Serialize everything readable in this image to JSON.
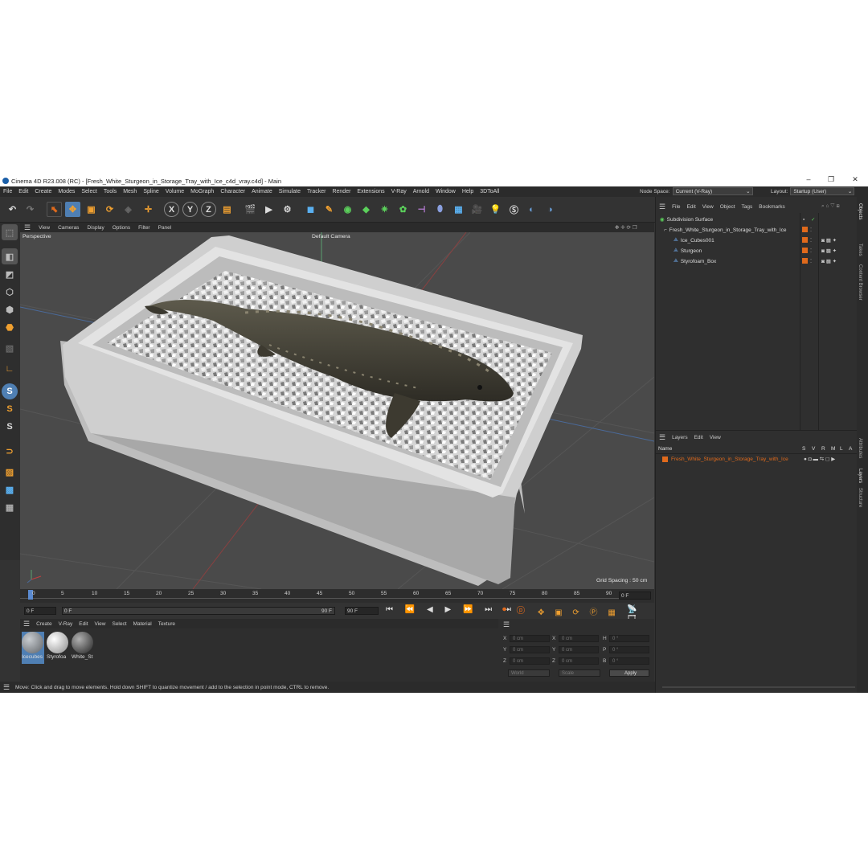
{
  "title": "Cinema 4D R23.008 (RC) - [Fresh_White_Sturgeon_in_Storage_Tray_with_Ice_c4d_vray.c4d] - Main",
  "menu": [
    "File",
    "Edit",
    "Create",
    "Modes",
    "Select",
    "Tools",
    "Mesh",
    "Spline",
    "Volume",
    "MoGraph",
    "Character",
    "Animate",
    "Simulate",
    "Tracker",
    "Render",
    "Extensions",
    "V-Ray",
    "Arnold",
    "Window",
    "Help",
    "3DToAll"
  ],
  "node_space_label": "Node Space:",
  "node_space_value": "Current (V-Ray)",
  "layout_label": "Layout:",
  "layout_value": "Startup (User)",
  "viewport": {
    "menu": [
      "View",
      "Cameras",
      "Display",
      "Options",
      "Filter",
      "Panel"
    ],
    "name": "Perspective",
    "camera": "Default Camera",
    "grid_spacing": "Grid Spacing : 50 cm"
  },
  "timeline": {
    "ticks": [
      "0",
      "5",
      "10",
      "15",
      "20",
      "25",
      "30",
      "35",
      "40",
      "45",
      "50",
      "55",
      "60",
      "65",
      "70",
      "75",
      "80",
      "85",
      "90"
    ],
    "current_frame": "0 F",
    "start": "0 F",
    "range_start": "0 F",
    "range_end": "90 F",
    "end": "90 F"
  },
  "material_menu": [
    "Create",
    "V-Ray",
    "Edit",
    "View",
    "Select",
    "Material",
    "Texture"
  ],
  "materials": [
    {
      "name": "Icecubes",
      "color": "#8c9096"
    },
    {
      "name": "Styrofoa",
      "color": "#d0d0d0"
    },
    {
      "name": "White_St",
      "color": "#5a5c60"
    }
  ],
  "coords": {
    "rows": [
      {
        "a": "X",
        "av": "0 cm",
        "b": "X",
        "bv": "0 cm",
        "c": "H",
        "cv": "0 °"
      },
      {
        "a": "Y",
        "av": "0 cm",
        "b": "Y",
        "bv": "0 cm",
        "c": "P",
        "cv": "0 °"
      },
      {
        "a": "Z",
        "av": "0 cm",
        "b": "Z",
        "bv": "0 cm",
        "c": "B",
        "cv": "0 °"
      }
    ],
    "world": "World",
    "scale": "Scale",
    "apply": "Apply"
  },
  "status": "Move: Click and drag to move elements. Hold down SHIFT to quantize movement / add to the selection in point mode, CTRL to remove.",
  "objects": {
    "menu": [
      "File",
      "Edit",
      "View",
      "Object",
      "Tags",
      "Bookmarks"
    ],
    "items": [
      "Subdivision Surface",
      "Fresh_White_Sturgeon_in_Storage_Tray_with_Ice",
      "Ice_Cubes001",
      "Sturgeon",
      "Styrofoam_Box"
    ]
  },
  "layers": {
    "menu": [
      "Layers",
      "Edit",
      "View"
    ],
    "header_name": "Name",
    "header_cols": [
      "S",
      "V",
      "R",
      "M",
      "L",
      "A"
    ],
    "item": "Fresh_White_Sturgeon_in_Storage_Tray_with_Ice"
  },
  "side_tabs": [
    "Objects",
    "Takes",
    "Content Browser",
    "Attributes",
    "Layers",
    "Structure"
  ],
  "colors": {
    "accent": "#e06a1c",
    "selected_blue": "#4f7fb3"
  }
}
